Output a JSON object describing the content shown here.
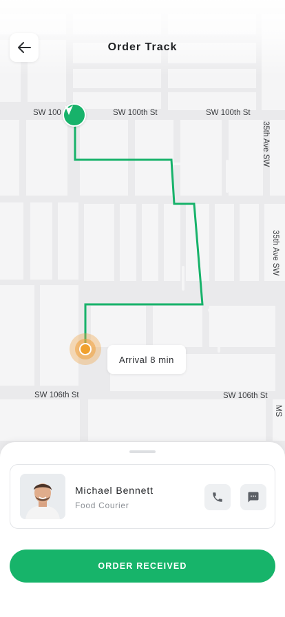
{
  "header": {
    "title": "Order Track",
    "back_icon": "arrow-left-icon"
  },
  "map": {
    "streets": {
      "sw100_a": "SW 100",
      "sw100_b": "SW 100th St",
      "sw100_c": "SW 100th St",
      "ave35_a": "35th Ave SW",
      "ave35_b": "35th Ave SW",
      "sw106_a": "SW 106th St",
      "sw106_b": "SW 106th St",
      "ms_edge": "MS"
    },
    "arrival_text": "Arrival 8 min",
    "route_color": "#17b26a",
    "courier_marker_color": "#f0a12e",
    "start_pin_icon": "navigation-arrow-icon"
  },
  "courier": {
    "name": "Michael Bennett",
    "role": "Food Courier",
    "avatar": "courier-avatar",
    "call_icon": "phone-icon",
    "message_icon": "chat-icon"
  },
  "actions": {
    "order_received_label": "ORDER RECEIVED"
  },
  "colors": {
    "accent": "#17b46a",
    "map_background": "#eaeaec",
    "block": "#f6f6f7"
  }
}
